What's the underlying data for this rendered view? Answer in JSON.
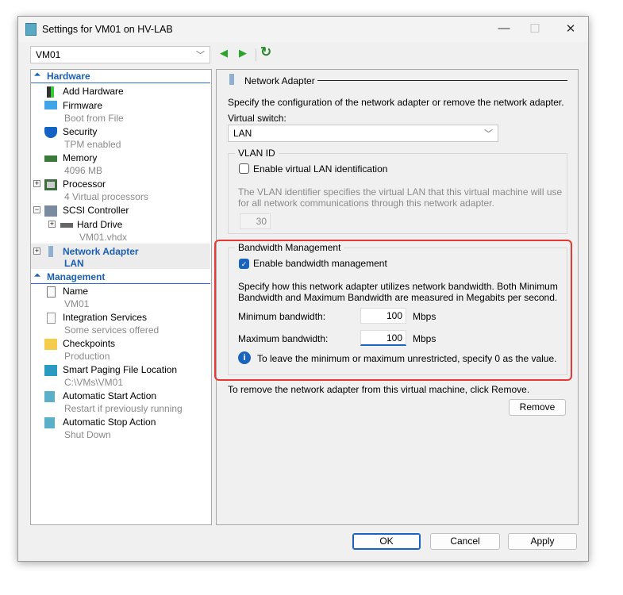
{
  "window": {
    "title": "Settings for VM01 on HV-LAB",
    "minimize": "—",
    "maximize": "☐",
    "close": "✕"
  },
  "vm_selector": {
    "value": "VM01"
  },
  "nav": {
    "back": "◀",
    "forward": "▶",
    "refresh": "↻"
  },
  "sidebar": {
    "hardware_label": "Hardware",
    "management_label": "Management",
    "hardware": [
      {
        "label": "Add Hardware",
        "sub": "",
        "icon": "add-hardware-icon"
      },
      {
        "label": "Firmware",
        "sub": "Boot from File",
        "icon": "monitor-icon"
      },
      {
        "label": "Security",
        "sub": "TPM enabled",
        "icon": "shield-icon"
      },
      {
        "label": "Memory",
        "sub": "4096 MB",
        "icon": "memory-icon"
      },
      {
        "label": "Processor",
        "sub": "4 Virtual processors",
        "icon": "cpu-icon"
      },
      {
        "label": "SCSI Controller",
        "sub": "",
        "icon": "scsi-icon"
      },
      {
        "label": "Hard Drive",
        "sub": "VM01.vhdx",
        "icon": "hard-drive-icon"
      },
      {
        "label": "Network Adapter",
        "sub": "LAN",
        "icon": "network-adapter-icon"
      }
    ],
    "management": [
      {
        "label": "Name",
        "sub": "VM01",
        "icon": "name-icon"
      },
      {
        "label": "Integration Services",
        "sub": "Some services offered",
        "icon": "checklist-icon"
      },
      {
        "label": "Checkpoints",
        "sub": "Production",
        "icon": "checkpoint-icon"
      },
      {
        "label": "Smart Paging File Location",
        "sub": "C:\\VMs\\VM01",
        "icon": "paging-icon"
      },
      {
        "label": "Automatic Start Action",
        "sub": "Restart if previously running",
        "icon": "start-action-icon"
      },
      {
        "label": "Automatic Stop Action",
        "sub": "Shut Down",
        "icon": "stop-action-icon"
      }
    ]
  },
  "main": {
    "heading": "Network Adapter",
    "intro": "Specify the configuration of the network adapter or remove the network adapter.",
    "virtual_switch_label": "Virtual switch:",
    "virtual_switch_value": "LAN",
    "vlan": {
      "title": "VLAN ID",
      "checkbox": "Enable virtual LAN identification",
      "checked": false,
      "desc": "The VLAN identifier specifies the virtual LAN that this virtual machine will use for all network communications through this network adapter.",
      "value": "30"
    },
    "bandwidth": {
      "title": "Bandwidth Management",
      "checkbox": "Enable bandwidth management",
      "checked": true,
      "desc": "Specify how this network adapter utilizes network bandwidth. Both Minimum Bandwidth and Maximum Bandwidth are measured in Megabits per second.",
      "min_label": "Minimum bandwidth:",
      "min_value": "100",
      "max_label": "Maximum bandwidth:",
      "max_value": "100",
      "unit": "Mbps",
      "info": "To leave the minimum or maximum unrestricted, specify 0 as the value."
    },
    "remove_text": "To remove the network adapter from this virtual machine, click Remove.",
    "remove_button": "Remove"
  },
  "footer": {
    "ok": "OK",
    "cancel": "Cancel",
    "apply": "Apply"
  },
  "colors": {
    "highlight": "#e53935",
    "accent": "#1a64c0"
  }
}
